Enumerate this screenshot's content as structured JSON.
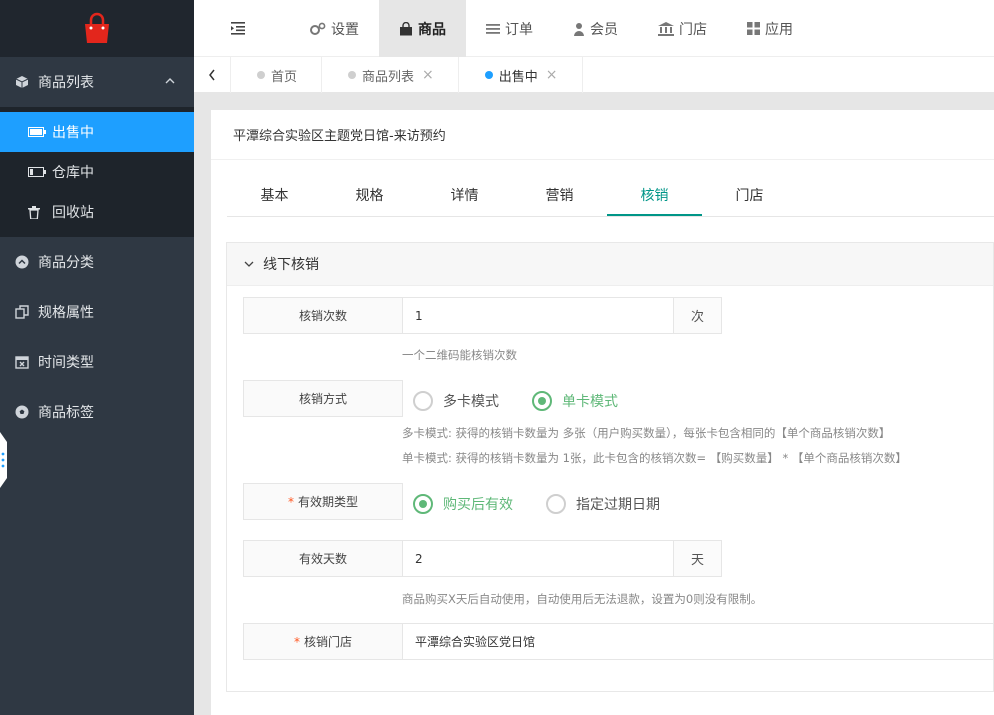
{
  "sidebar": {
    "group_products": "商品列表",
    "sub_items": [
      "出售中",
      "仓库中",
      "回收站"
    ],
    "groups": [
      "商品分类",
      "规格属性",
      "时间类型",
      "商品标签"
    ]
  },
  "topnav": [
    "设置",
    "商品",
    "订单",
    "会员",
    "门店",
    "应用"
  ],
  "tabs": [
    {
      "label": "首页"
    },
    {
      "label": "商品列表",
      "close": "×"
    },
    {
      "label": "出售中",
      "close": "×"
    }
  ],
  "card": {
    "title": "平潭综合实验区主题党日馆-来访预约",
    "tabs": [
      "基本",
      "规格",
      "详情",
      "营销",
      "核销",
      "门店"
    ]
  },
  "panel": {
    "title": "线下核销",
    "count": {
      "label": "核销次数",
      "value": "1",
      "suffix": "次",
      "hint": "一个二维码能核销次数"
    },
    "mode": {
      "label": "核销方式",
      "options": [
        "多卡模式",
        "单卡模式"
      ],
      "hint1": "多卡模式: 获得的核销卡数量为 多张（用户购买数量），每张卡包含相同的【单个商品核销次数】",
      "hint2": "单卡模式: 获得的核销卡数量为 1张，此卡包含的核销次数= 【购买数量】 * 【单个商品核销次数】"
    },
    "validity_type": {
      "required": "*",
      "label": "有效期类型",
      "options": [
        "购买后有效",
        "指定过期日期"
      ]
    },
    "valid_days": {
      "label": "有效天数",
      "value": "2",
      "suffix": "天",
      "hint": "商品购买X天后自动使用，自动使用后无法退款，设置为0则没有限制。"
    },
    "store": {
      "required": "*",
      "label": "核销门店",
      "value": "平潭综合实验区党日馆"
    }
  },
  "colors": {
    "accent": "#1e9fff",
    "green": "#5fb878",
    "teal": "#009688",
    "sidebar": "#2f3843"
  }
}
